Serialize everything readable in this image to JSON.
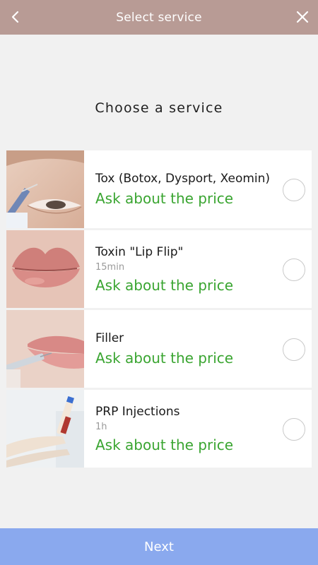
{
  "header": {
    "title": "Select service",
    "back_icon": "chevron-left-icon",
    "close_icon": "close-icon"
  },
  "section_title": "Choose a service",
  "services": [
    {
      "name": "Tox (Botox, Dysport, Xeomin)",
      "duration": "",
      "price": "Ask about the price",
      "image": "botox-injection-photo"
    },
    {
      "name": "Toxin \"Lip Flip\"",
      "duration": "15min",
      "price": "Ask about the price",
      "image": "lips-photo"
    },
    {
      "name": "Filler",
      "duration": "",
      "price": "Ask about the price",
      "image": "lip-filler-injection-photo"
    },
    {
      "name": "PRP Injections",
      "duration": "1h",
      "price": "Ask about the price",
      "image": "blood-vial-photo"
    }
  ],
  "next_button": "Next",
  "colors": {
    "header": "#b89b95",
    "price": "#3aa531",
    "next": "#8aa9ee"
  }
}
